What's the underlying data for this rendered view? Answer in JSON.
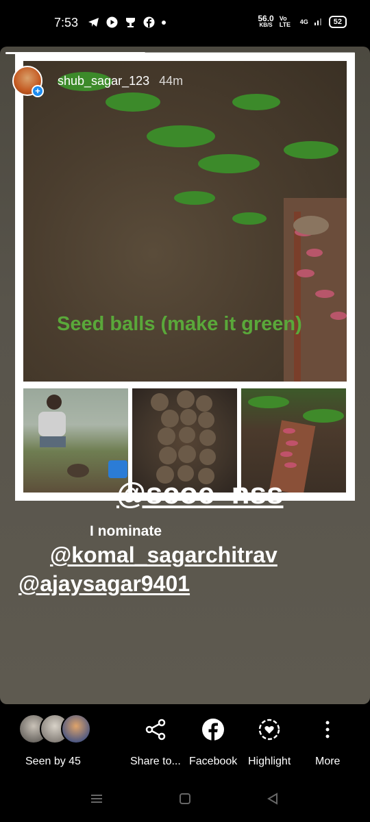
{
  "status_bar": {
    "time": "7:53",
    "net_speed": "56.0",
    "net_unit": "KB/S",
    "network": "Vo LTE",
    "signal": "4G",
    "battery": "52"
  },
  "story": {
    "username": "shub_sagar_123",
    "time_ago": "44m",
    "progress": 0.4,
    "overlay_caption": "Seed balls (make it green)",
    "mention_main": "@scoe_nss",
    "nominate_text": "I nominate",
    "mention_2": "@komal_sagarchitrav",
    "mention_3": "@ajaysagar9401"
  },
  "actions": {
    "seen_label": "Seen by 45",
    "share": "Share to...",
    "facebook": "Facebook",
    "highlight": "Highlight",
    "more": "More"
  },
  "icons": {
    "share": "share-icon",
    "facebook": "facebook-icon",
    "highlight": "highlight-icon",
    "more": "more-vertical-icon"
  },
  "colors": {
    "caption_green": "#5aa83a",
    "story_bg": "#55514a",
    "avatar_plus": "#1d8cf0"
  }
}
